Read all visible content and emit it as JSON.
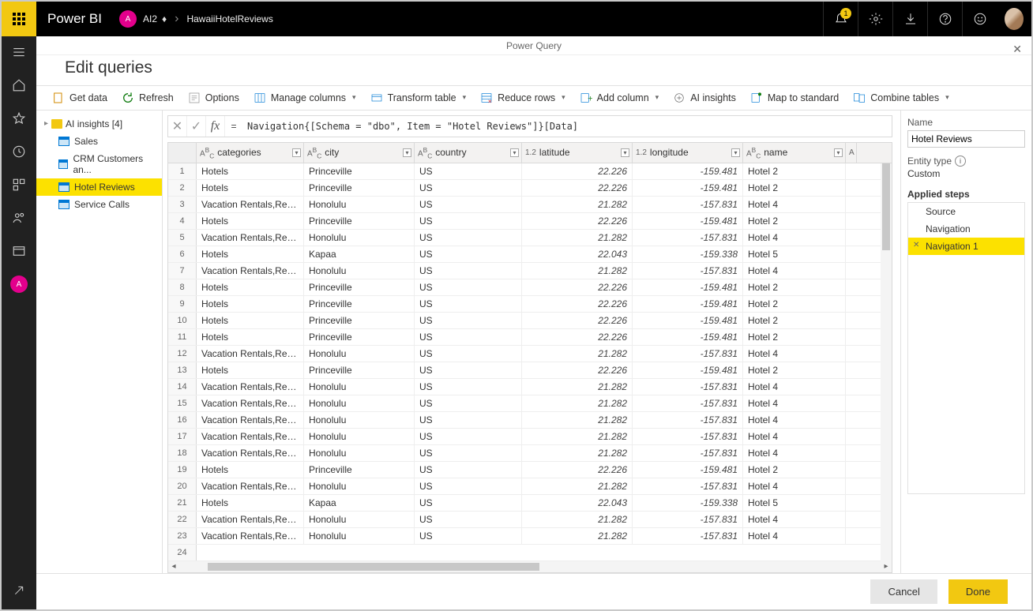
{
  "brand": "Power BI",
  "workspace_badge": "A",
  "breadcrumb": {
    "workspace": "AI2",
    "item": "HawaiiHotelReviews"
  },
  "notifications_badge": "1",
  "modal": {
    "header": "Power Query",
    "title": "Edit queries"
  },
  "ribbon": {
    "get_data": "Get data",
    "refresh": "Refresh",
    "options": "Options",
    "manage_columns": "Manage columns",
    "transform_table": "Transform table",
    "reduce_rows": "Reduce rows",
    "add_column": "Add column",
    "ai_insights": "AI insights",
    "map_to_standard": "Map to standard",
    "combine_tables": "Combine tables"
  },
  "queries": {
    "folder": "AI insights [4]",
    "items": [
      "Sales",
      "CRM Customers an...",
      "Hotel Reviews",
      "Service Calls"
    ],
    "selected": 2
  },
  "formula": "Navigation{[Schema = \"dbo\", Item = \"Hotel Reviews\"]}[Data]",
  "columns": [
    {
      "key": "categories",
      "label": "categories",
      "type": "ABC",
      "cls": "col-cat"
    },
    {
      "key": "city",
      "label": "city",
      "type": "ABC",
      "cls": "col-city"
    },
    {
      "key": "country",
      "label": "country",
      "type": "ABC",
      "cls": "col-country"
    },
    {
      "key": "latitude",
      "label": "latitude",
      "type": "1.2",
      "cls": "col-lat",
      "num": true
    },
    {
      "key": "longitude",
      "label": "longitude",
      "type": "1.2",
      "cls": "col-lon",
      "num": true
    },
    {
      "key": "name",
      "label": "name",
      "type": "ABC",
      "cls": "col-name"
    }
  ],
  "rows": [
    {
      "categories": "Hotels",
      "city": "Princeville",
      "country": "US",
      "latitude": "22.226",
      "longitude": "-159.481",
      "name": "Hotel 2"
    },
    {
      "categories": "Hotels",
      "city": "Princeville",
      "country": "US",
      "latitude": "22.226",
      "longitude": "-159.481",
      "name": "Hotel 2"
    },
    {
      "categories": "Vacation Rentals,Resorts &...",
      "city": "Honolulu",
      "country": "US",
      "latitude": "21.282",
      "longitude": "-157.831",
      "name": "Hotel 4"
    },
    {
      "categories": "Hotels",
      "city": "Princeville",
      "country": "US",
      "latitude": "22.226",
      "longitude": "-159.481",
      "name": "Hotel 2"
    },
    {
      "categories": "Vacation Rentals,Resorts &...",
      "city": "Honolulu",
      "country": "US",
      "latitude": "21.282",
      "longitude": "-157.831",
      "name": "Hotel 4"
    },
    {
      "categories": "Hotels",
      "city": "Kapaa",
      "country": "US",
      "latitude": "22.043",
      "longitude": "-159.338",
      "name": "Hotel 5"
    },
    {
      "categories": "Vacation Rentals,Resorts &...",
      "city": "Honolulu",
      "country": "US",
      "latitude": "21.282",
      "longitude": "-157.831",
      "name": "Hotel 4"
    },
    {
      "categories": "Hotels",
      "city": "Princeville",
      "country": "US",
      "latitude": "22.226",
      "longitude": "-159.481",
      "name": "Hotel 2"
    },
    {
      "categories": "Hotels",
      "city": "Princeville",
      "country": "US",
      "latitude": "22.226",
      "longitude": "-159.481",
      "name": "Hotel 2"
    },
    {
      "categories": "Hotels",
      "city": "Princeville",
      "country": "US",
      "latitude": "22.226",
      "longitude": "-159.481",
      "name": "Hotel 2"
    },
    {
      "categories": "Hotels",
      "city": "Princeville",
      "country": "US",
      "latitude": "22.226",
      "longitude": "-159.481",
      "name": "Hotel 2"
    },
    {
      "categories": "Vacation Rentals,Resorts &...",
      "city": "Honolulu",
      "country": "US",
      "latitude": "21.282",
      "longitude": "-157.831",
      "name": "Hotel 4"
    },
    {
      "categories": "Hotels",
      "city": "Princeville",
      "country": "US",
      "latitude": "22.226",
      "longitude": "-159.481",
      "name": "Hotel 2"
    },
    {
      "categories": "Vacation Rentals,Resorts &...",
      "city": "Honolulu",
      "country": "US",
      "latitude": "21.282",
      "longitude": "-157.831",
      "name": "Hotel 4"
    },
    {
      "categories": "Vacation Rentals,Resorts &...",
      "city": "Honolulu",
      "country": "US",
      "latitude": "21.282",
      "longitude": "-157.831",
      "name": "Hotel 4"
    },
    {
      "categories": "Vacation Rentals,Resorts &...",
      "city": "Honolulu",
      "country": "US",
      "latitude": "21.282",
      "longitude": "-157.831",
      "name": "Hotel 4"
    },
    {
      "categories": "Vacation Rentals,Resorts &...",
      "city": "Honolulu",
      "country": "US",
      "latitude": "21.282",
      "longitude": "-157.831",
      "name": "Hotel 4"
    },
    {
      "categories": "Vacation Rentals,Resorts &...",
      "city": "Honolulu",
      "country": "US",
      "latitude": "21.282",
      "longitude": "-157.831",
      "name": "Hotel 4"
    },
    {
      "categories": "Hotels",
      "city": "Princeville",
      "country": "US",
      "latitude": "22.226",
      "longitude": "-159.481",
      "name": "Hotel 2"
    },
    {
      "categories": "Vacation Rentals,Resorts &...",
      "city": "Honolulu",
      "country": "US",
      "latitude": "21.282",
      "longitude": "-157.831",
      "name": "Hotel 4"
    },
    {
      "categories": "Hotels",
      "city": "Kapaa",
      "country": "US",
      "latitude": "22.043",
      "longitude": "-159.338",
      "name": "Hotel 5"
    },
    {
      "categories": "Vacation Rentals,Resorts &...",
      "city": "Honolulu",
      "country": "US",
      "latitude": "21.282",
      "longitude": "-157.831",
      "name": "Hotel 4"
    },
    {
      "categories": "Vacation Rentals,Resorts &...",
      "city": "Honolulu",
      "country": "US",
      "latitude": "21.282",
      "longitude": "-157.831",
      "name": "Hotel 4"
    }
  ],
  "extra_row_num": "24",
  "right": {
    "name_label": "Name",
    "name_value": "Hotel Reviews",
    "entity_label": "Entity type",
    "entity_value": "Custom",
    "steps_label": "Applied steps",
    "steps": [
      "Source",
      "Navigation",
      "Navigation 1"
    ],
    "selected_step": 2
  },
  "footer": {
    "cancel": "Cancel",
    "done": "Done"
  }
}
